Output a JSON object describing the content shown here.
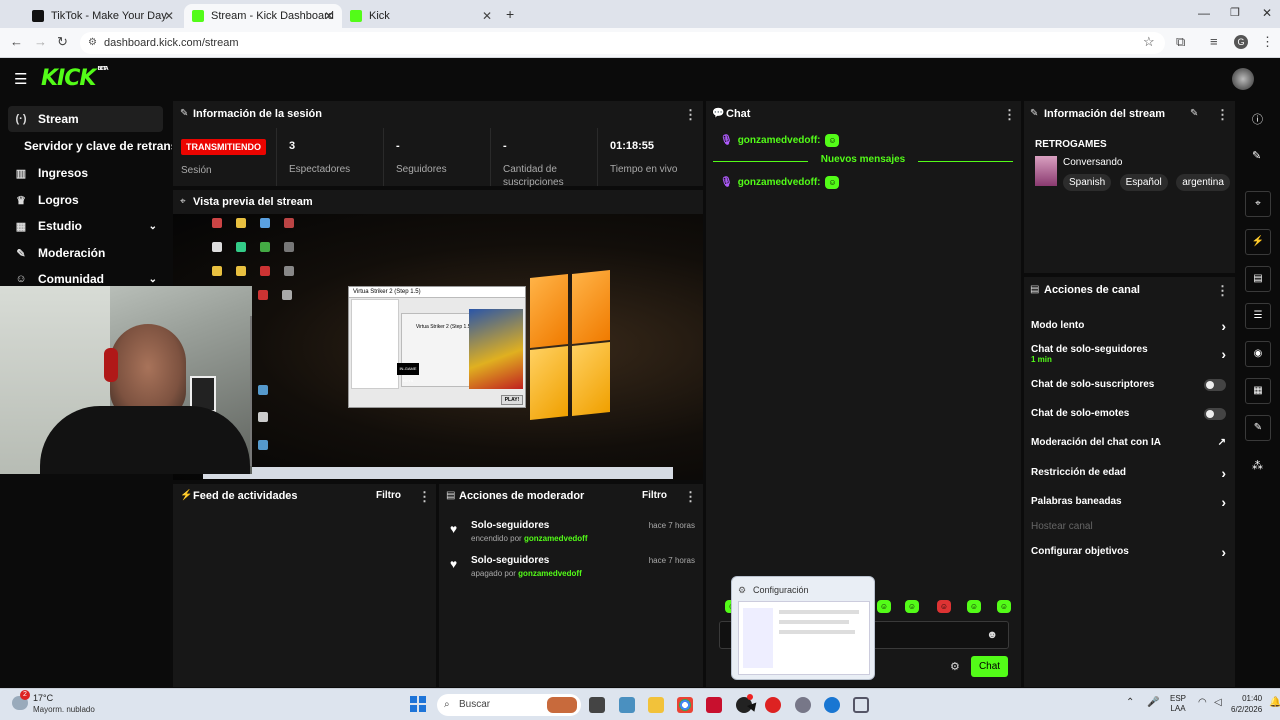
{
  "browser": {
    "tabs": [
      {
        "title": "TikTok - Make Your Day"
      },
      {
        "title": "Stream - Kick Dashboard"
      },
      {
        "title": "Kick"
      }
    ],
    "url": "dashboard.kick.com/stream",
    "profile_initial": "G"
  },
  "header": {
    "logo": "KICK",
    "logo_badge": "BETA"
  },
  "sidebar": {
    "items": [
      {
        "label": "Stream",
        "icon": "broadcast-icon"
      },
      {
        "label": "Servidor y clave de retransm",
        "icon": ""
      },
      {
        "label": "Ingresos",
        "icon": "chart-icon"
      },
      {
        "label": "Logros",
        "icon": "trophy-icon"
      },
      {
        "label": "Estudio",
        "icon": "grid-icon"
      },
      {
        "label": "Moderación",
        "icon": "wrench-icon"
      },
      {
        "label": "Comunidad",
        "icon": "people-icon"
      }
    ]
  },
  "session": {
    "title": "Información de la sesión",
    "live_badge": "TRANSMITIENDO",
    "session_label": "Sesión",
    "stats": [
      {
        "value": "3",
        "label": "Espectadores"
      },
      {
        "value": "-",
        "label": "Seguidores"
      },
      {
        "value": "-",
        "label": "Cantidad de suscripciones"
      },
      {
        "value": "01:18:55",
        "label": "Tiempo en vivo"
      }
    ]
  },
  "preview": {
    "title": "Vista previa del stream",
    "game_window_title": "Virtua Striker 2 (Step 1.5)",
    "game_window_sub": "Virtua Striker 2 (Step 1.5)",
    "play_button": "PLAY!"
  },
  "activity": {
    "title": "Feed de actividades",
    "filter": "Filtro"
  },
  "mod_actions": {
    "title": "Acciones de moderador",
    "filter": "Filtro",
    "items": [
      {
        "heading": "Solo-seguidores",
        "time": "hace 7 horas",
        "prefix": "encendido por",
        "user": "gonzamedvedoff"
      },
      {
        "heading": "Solo-seguidores",
        "time": "hace 7 horas",
        "prefix": "apagado por",
        "user": "gonzamedvedoff"
      }
    ]
  },
  "chat": {
    "title": "Chat",
    "messages": [
      {
        "user": "gonzamedvedoff:"
      },
      {
        "user": "gonzamedvedoff:"
      }
    ],
    "new_messages": "Nuevos mensajes",
    "send_button": "Chat"
  },
  "stream_info": {
    "title": "Información del stream",
    "stream_title": "RETROGAMES",
    "category": "Conversando",
    "tags": [
      "Spanish",
      "Español",
      "argentina"
    ]
  },
  "channel_actions": {
    "title": "Acciones de canal",
    "items": [
      {
        "label": "Modo lento",
        "control": "chevron"
      },
      {
        "label": "Chat de solo-seguidores",
        "sub": "1 min",
        "control": "chevron"
      },
      {
        "label": "Chat de solo-suscriptores",
        "control": "toggle"
      },
      {
        "label": "Chat de solo-emotes",
        "control": "toggle"
      },
      {
        "label": "Moderación del chat con IA",
        "control": "external"
      },
      {
        "label": "Restricción de edad",
        "control": "chevron"
      },
      {
        "label": "Palabras baneadas",
        "control": "chevron"
      },
      {
        "label": "Hostear canal",
        "control": "none",
        "disabled": true
      },
      {
        "label": "Configurar objetivos",
        "control": "chevron"
      }
    ]
  },
  "popup": {
    "title": "Configuración"
  },
  "taskbar": {
    "weather_temp": "17°C",
    "weather_desc": "Mayorm. nublado",
    "weather_alert": "2",
    "search_placeholder": "Buscar",
    "lang_top": "ESP",
    "lang_bottom": "LAA",
    "time": "01:40",
    "date": "6/2/2026"
  },
  "colors": {
    "accent": "#53fc18",
    "live": "#eb0400",
    "panel": "#171717",
    "bg": "#0b0b0b"
  }
}
